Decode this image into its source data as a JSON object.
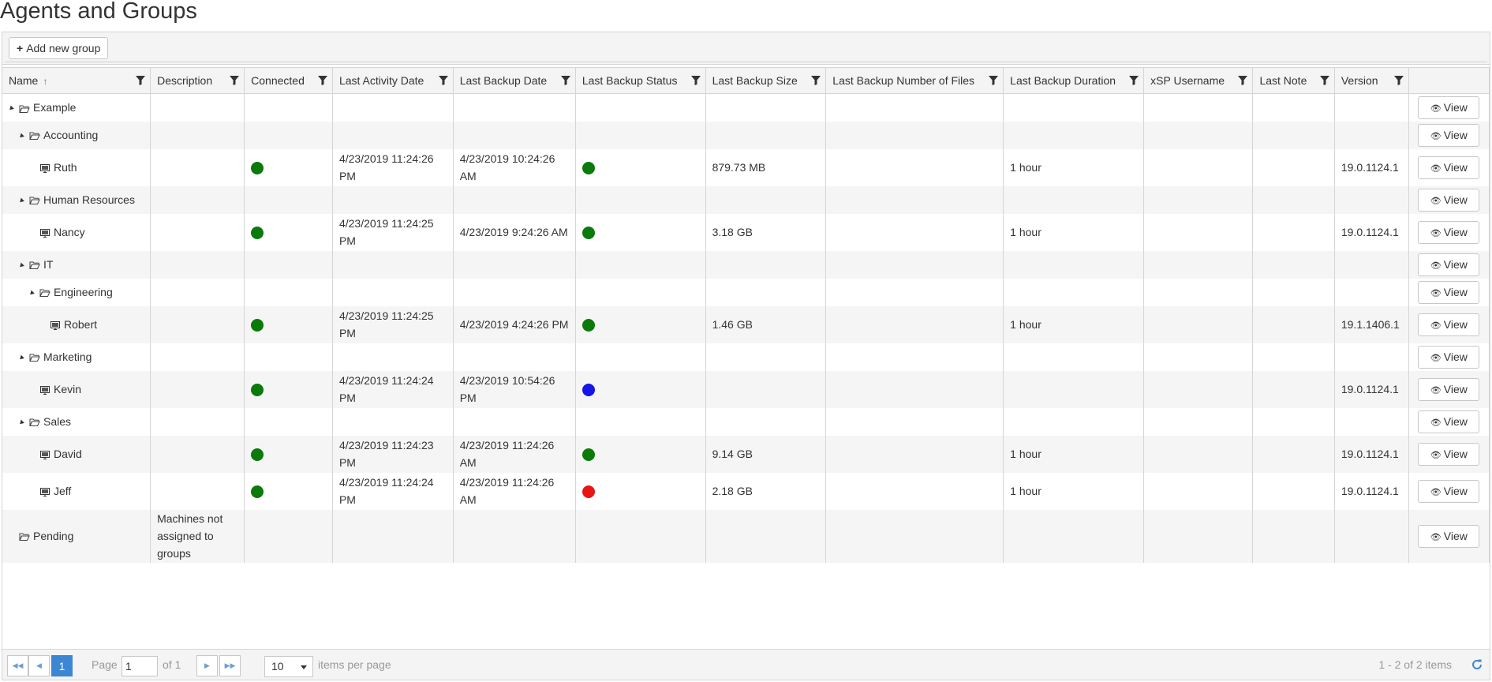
{
  "page_title": "Agents and Groups",
  "toolbar": {
    "add_group_label": "Add new group"
  },
  "columns": {
    "name": "Name",
    "description": "Description",
    "connected": "Connected",
    "last_activity": "Last Activity Date",
    "last_backup_date": "Last Backup Date",
    "last_backup_status": "Last Backup Status",
    "last_backup_size": "Last Backup Size",
    "last_backup_files": "Last Backup Number of Files",
    "last_backup_duration": "Last Backup Duration",
    "xsp_username": "xSP Username",
    "last_note": "Last Note",
    "version": "Version"
  },
  "view_label": "View",
  "status_colors": {
    "connected": "#0a7a0a",
    "success": "#0a7a0a",
    "in_progress": "#1515e6",
    "failed": "#e81515"
  },
  "rows": [
    {
      "type": "group",
      "indent": 0,
      "expanded": true,
      "name": "Example",
      "description": "",
      "last_activity_date": "",
      "last_backup_date": "",
      "last_backup_size": "",
      "last_backup_duration": "",
      "version": ""
    },
    {
      "type": "group",
      "indent": 1,
      "expanded": true,
      "name": "Accounting",
      "description": "",
      "last_activity_date": "",
      "last_backup_date": "",
      "last_backup_size": "",
      "last_backup_duration": "",
      "version": ""
    },
    {
      "type": "agent",
      "indent": 2,
      "name": "Ruth",
      "description": "",
      "connected": "connected",
      "last_activity_date": "4/23/2019 11:24:26 PM",
      "last_backup_date": "4/23/2019 10:24:26 AM",
      "backup_status": "success",
      "last_backup_size": "879.73 MB",
      "last_backup_duration": "1 hour",
      "version": "19.0.1124.1"
    },
    {
      "type": "group",
      "indent": 1,
      "expanded": true,
      "name": "Human Resources",
      "description": "",
      "last_activity_date": "",
      "last_backup_date": "",
      "last_backup_size": "",
      "last_backup_duration": "",
      "version": ""
    },
    {
      "type": "agent",
      "indent": 2,
      "name": "Nancy",
      "description": "",
      "connected": "connected",
      "last_activity_date": "4/23/2019 11:24:25 PM",
      "last_backup_date": "4/23/2019 9:24:26 AM",
      "backup_status": "success",
      "last_backup_size": "3.18 GB",
      "last_backup_duration": "1 hour",
      "version": "19.0.1124.1"
    },
    {
      "type": "group",
      "indent": 1,
      "expanded": true,
      "name": "IT",
      "description": "",
      "last_activity_date": "",
      "last_backup_date": "",
      "last_backup_size": "",
      "last_backup_duration": "",
      "version": ""
    },
    {
      "type": "group",
      "indent": 2,
      "expanded": true,
      "name": "Engineering",
      "description": "",
      "last_activity_date": "",
      "last_backup_date": "",
      "last_backup_size": "",
      "last_backup_duration": "",
      "version": ""
    },
    {
      "type": "agent",
      "indent": 3,
      "name": "Robert",
      "description": "",
      "connected": "connected",
      "last_activity_date": "4/23/2019 11:24:25 PM",
      "last_backup_date": "4/23/2019 4:24:26 PM",
      "backup_status": "success",
      "last_backup_size": "1.46 GB",
      "last_backup_duration": "1 hour",
      "version": "19.1.1406.1"
    },
    {
      "type": "group",
      "indent": 1,
      "expanded": true,
      "name": "Marketing",
      "description": "",
      "last_activity_date": "",
      "last_backup_date": "",
      "last_backup_size": "",
      "last_backup_duration": "",
      "version": ""
    },
    {
      "type": "agent",
      "indent": 2,
      "name": "Kevin",
      "description": "",
      "connected": "connected",
      "last_activity_date": "4/23/2019 11:24:24 PM",
      "last_backup_date": "4/23/2019 10:54:26 PM",
      "backup_status": "in_progress",
      "last_backup_size": "",
      "last_backup_duration": "",
      "version": "19.0.1124.1"
    },
    {
      "type": "group",
      "indent": 1,
      "expanded": true,
      "name": "Sales",
      "description": "",
      "last_activity_date": "",
      "last_backup_date": "",
      "last_backup_size": "",
      "last_backup_duration": "",
      "version": ""
    },
    {
      "type": "agent",
      "indent": 2,
      "name": "David",
      "description": "",
      "connected": "connected",
      "last_activity_date": "4/23/2019 11:24:23 PM",
      "last_backup_date": "4/23/2019 11:24:26 AM",
      "backup_status": "success",
      "last_backup_size": "9.14 GB",
      "last_backup_duration": "1 hour",
      "version": "19.0.1124.1"
    },
    {
      "type": "agent",
      "indent": 2,
      "name": "Jeff",
      "description": "",
      "connected": "connected",
      "last_activity_date": "4/23/2019 11:24:24 PM",
      "last_backup_date": "4/23/2019 11:24:26 AM",
      "backup_status": "failed",
      "last_backup_size": "2.18 GB",
      "last_backup_duration": "1 hour",
      "version": "19.0.1124.1"
    },
    {
      "type": "group",
      "indent": 0,
      "expanded": false,
      "name": "Pending",
      "description": "Machines not assigned to groups",
      "last_activity_date": "",
      "last_backup_date": "",
      "last_backup_size": "",
      "last_backup_duration": "",
      "version": ""
    }
  ],
  "pager": {
    "current_page": "1",
    "page_label": "Page",
    "page_input": "1",
    "of_label": "of 1",
    "page_size": "10",
    "items_per_page_label": "items per page",
    "info": "1 - 2 of 2 items"
  }
}
